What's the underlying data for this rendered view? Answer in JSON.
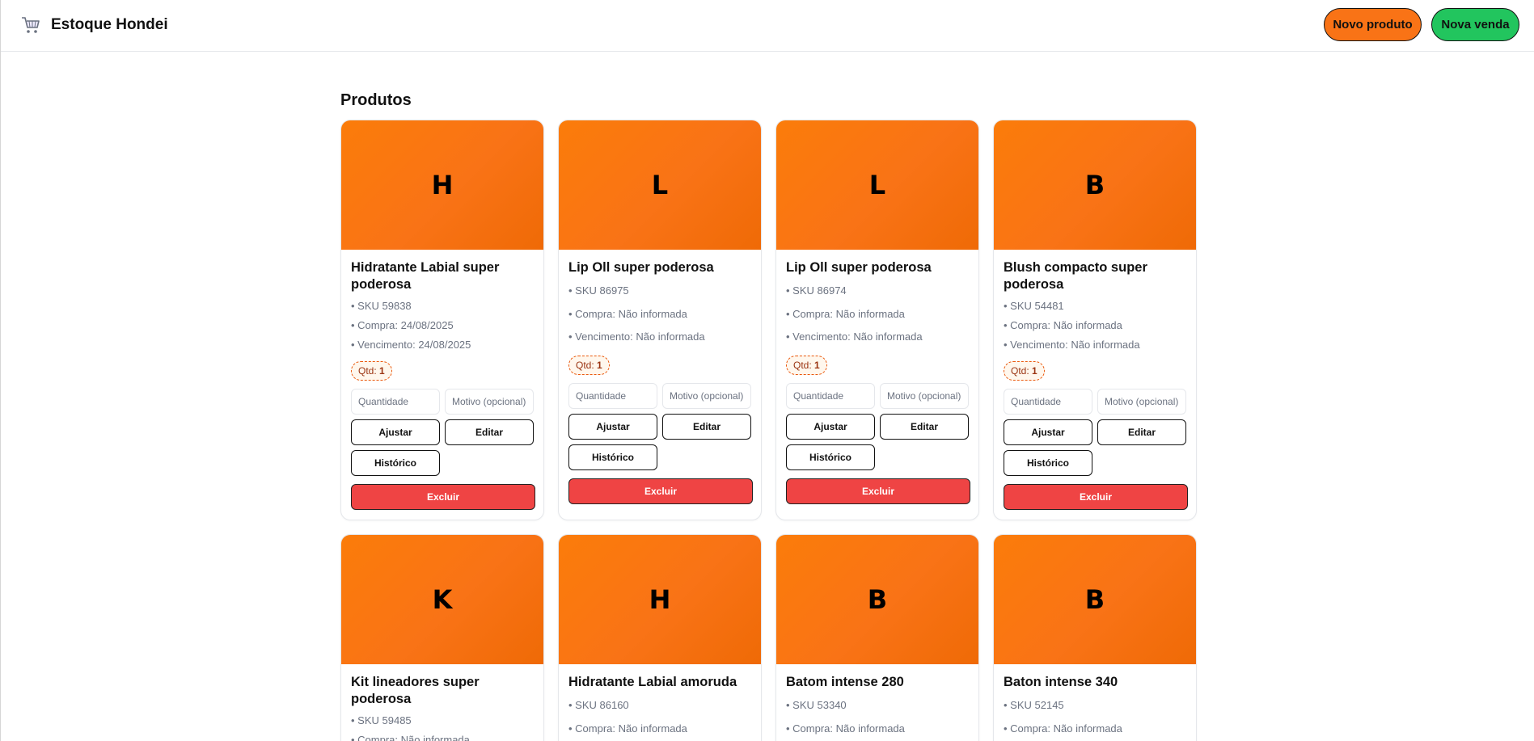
{
  "header": {
    "app_title": "Estoque Hondei",
    "logo_icon": "shopping-cart-icon",
    "new_product_label": "Novo produto",
    "new_sale_label": "Nova venda",
    "colors": {
      "new_product": "#f97316",
      "new_sale": "#22c55e"
    }
  },
  "main": {
    "section_title": "Produtos",
    "labels": {
      "quantity_placeholder": "Quantidade",
      "reason_placeholder": "Motivo (opcional)",
      "adjust": "Ajustar",
      "edit": "Editar",
      "history": "Histórico",
      "delete": "Excluir",
      "qty_prefix": "Qtd:"
    },
    "products": [
      {
        "initial": "H",
        "name": "Hidratante Labial super poderosa",
        "sku": "• SKU 59838",
        "purchase": "• Compra: 24/08/2025",
        "expiry": "• Vencimento: 24/08/2025",
        "qty": "1"
      },
      {
        "initial": "L",
        "name": "Lip Oll super poderosa",
        "sku": "• SKU 86975",
        "purchase": "• Compra: Não informada",
        "expiry": "• Vencimento: Não informada",
        "qty": "1"
      },
      {
        "initial": "L",
        "name": "Lip Oll super poderosa",
        "sku": "• SKU 86974",
        "purchase": "• Compra: Não informada",
        "expiry": "• Vencimento: Não informada",
        "qty": "1"
      },
      {
        "initial": "B",
        "name": "Blush compacto super poderosa",
        "sku": "• SKU 54481",
        "purchase": "• Compra: Não informada",
        "expiry": "• Vencimento: Não informada",
        "qty": "1"
      },
      {
        "initial": "K",
        "name": "Kit lineadores super poderosa",
        "sku": "• SKU 59485",
        "purchase": "• Compra: Não informada"
      },
      {
        "initial": "H",
        "name": "Hidratante Labial amoruda",
        "sku": "• SKU 86160",
        "purchase": "• Compra: Não informada"
      },
      {
        "initial": "B",
        "name": "Batom intense 280",
        "sku": "• SKU 53340",
        "purchase": "• Compra: Não informada"
      },
      {
        "initial": "B",
        "name": "Baton intense 340",
        "sku": "• SKU 52145",
        "purchase": "• Compra: Não informada"
      }
    ]
  }
}
